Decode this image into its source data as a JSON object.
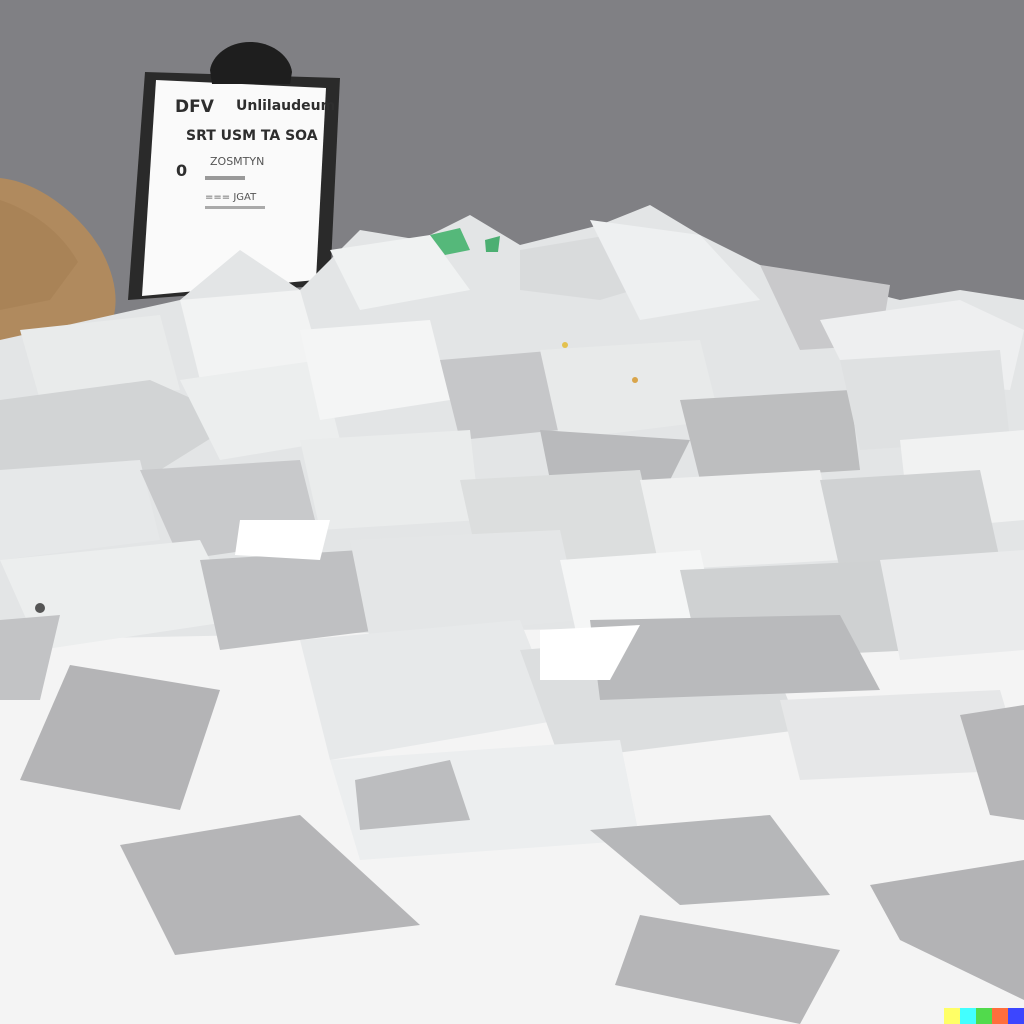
{
  "sign": {
    "line1_left": "DFV",
    "line1_right": "Unlilaudeum",
    "line2": "SRT USM TA SOA",
    "line3_left": "0",
    "line3_right": "ZOSMTYN",
    "line4": "=== JGAT"
  },
  "colors": {
    "background": "#808084",
    "paper": "#e8eaeb",
    "paper_shadow": "#b4b4b6",
    "floor": "#f7f7f7",
    "boulder": "#b48c5f",
    "clip": "#222222"
  },
  "color_bar": [
    "#ffff66",
    "#42ffff",
    "#51da4c",
    "#ff6e3c",
    "#3c46ff"
  ]
}
